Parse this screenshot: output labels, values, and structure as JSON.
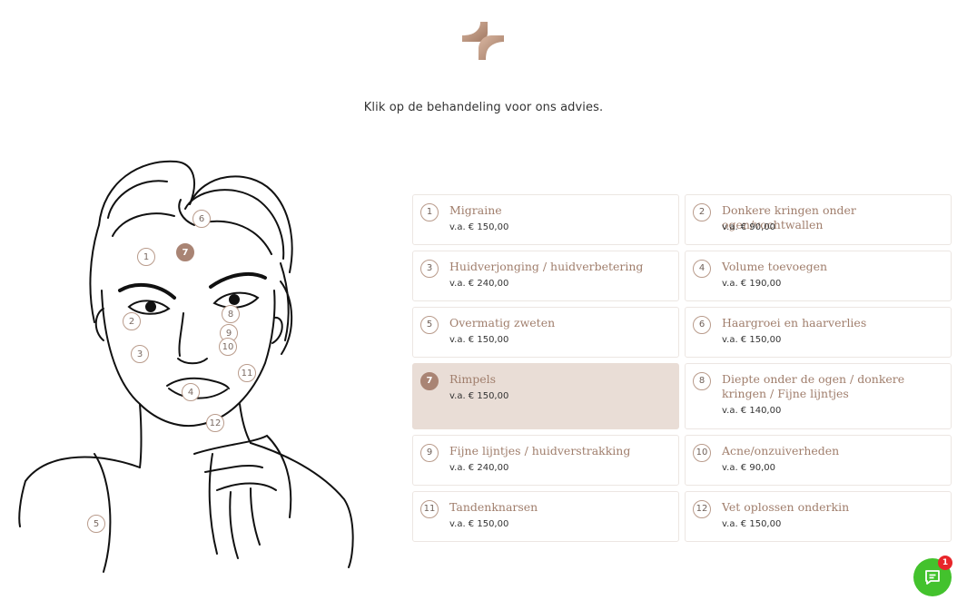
{
  "intro_text": "Klik op de behandeling voor ons advies.",
  "colors": {
    "accent": "#a98474",
    "title": "#a07e6c",
    "active_card": "#e9ddd6",
    "chat": "#43c22d",
    "badge": "#e8262a"
  },
  "face_markers": [
    "6",
    "7",
    "1",
    "2",
    "8",
    "9",
    "10",
    "3",
    "11",
    "4",
    "12",
    "5"
  ],
  "treatments": [
    {
      "num": "1",
      "title": "Migraine",
      "price": "v.a. € 150,00"
    },
    {
      "num": "2",
      "title": "Donkere kringen onder ogen/vochtwallen",
      "price": "v.a. € 90,00"
    },
    {
      "num": "3",
      "title": "Huidverjonging / huidverbetering",
      "price": "v.a. € 240,00"
    },
    {
      "num": "4",
      "title": "Volume toevoegen",
      "price": "v.a. € 190,00"
    },
    {
      "num": "5",
      "title": "Overmatig zweten",
      "price": "v.a. € 150,00"
    },
    {
      "num": "6",
      "title": "Haargroei en haarverlies",
      "price": "v.a. € 150,00"
    },
    {
      "num": "7",
      "title": "Rimpels",
      "price": "v.a. € 150,00"
    },
    {
      "num": "8",
      "title": "Diepte onder de ogen / donkere kringen / Fijne lijntjes",
      "price": "v.a. € 140,00"
    },
    {
      "num": "9",
      "title": "Fijne lijntjes / huidverstrakking",
      "price": "v.a. € 240,00"
    },
    {
      "num": "10",
      "title": "Acne/onzuiverheden",
      "price": "v.a. € 90,00"
    },
    {
      "num": "11",
      "title": "Tandenknarsen",
      "price": "v.a. € 150,00"
    },
    {
      "num": "12",
      "title": "Vet oplossen onderkin",
      "price": "v.a. € 150,00"
    }
  ],
  "active_treatment": "7",
  "chat": {
    "icon": "chat-icon",
    "badge_count": "1"
  }
}
